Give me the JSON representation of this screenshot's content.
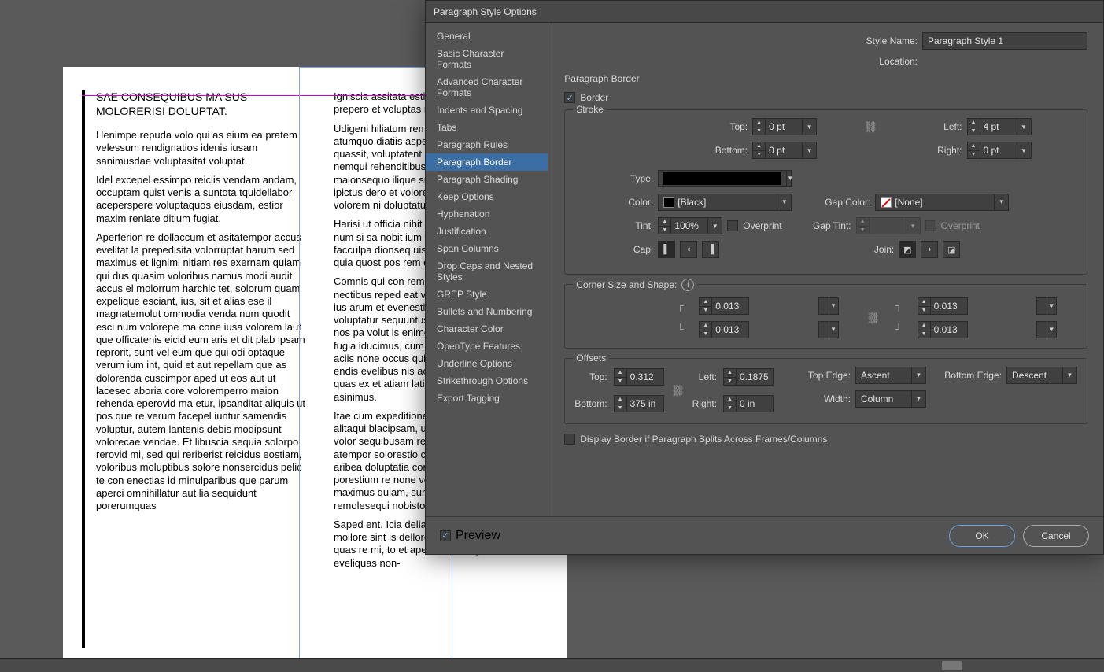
{
  "dialog": {
    "title": "Paragraph Style Options",
    "style_name_label": "Style Name:",
    "style_name_value": "Paragraph Style 1",
    "location_label": "Location:",
    "panel_title": "Paragraph Border",
    "preview_label": "Preview",
    "ok_label": "OK",
    "cancel_label": "Cancel"
  },
  "sidebar": {
    "items": [
      "General",
      "Basic Character Formats",
      "Advanced Character Formats",
      "Indents and Spacing",
      "Tabs",
      "Paragraph Rules",
      "Paragraph Border",
      "Paragraph Shading",
      "Keep Options",
      "Hyphenation",
      "Justification",
      "Span Columns",
      "Drop Caps and Nested Styles",
      "GREP Style",
      "Bullets and Numbering",
      "Character Color",
      "OpenType Features",
      "Underline Options",
      "Strikethrough Options",
      "Export Tagging"
    ],
    "active_index": 6
  },
  "border": {
    "checkbox_label": "Border",
    "stroke_legend": "Stroke",
    "top_label": "Top:",
    "top_value": "0 pt",
    "bottom_label": "Bottom:",
    "bottom_value": "0 pt",
    "left_label": "Left:",
    "left_value": "4 pt",
    "right_label": "Right:",
    "right_value": "0 pt",
    "type_label": "Type:",
    "color_label": "Color:",
    "color_value": "[Black]",
    "gap_color_label": "Gap Color:",
    "gap_color_value": "[None]",
    "tint_label": "Tint:",
    "tint_value": "100%",
    "overprint_label": "Overprint",
    "gap_tint_label": "Gap Tint:",
    "gap_overprint_label": "Overprint",
    "cap_label": "Cap:",
    "join_label": "Join:"
  },
  "corner": {
    "legend": "Corner Size and Shape:",
    "tl": "0.013",
    "tr": "0.013",
    "bl": "0.013",
    "br": "0.013"
  },
  "offsets": {
    "legend": "Offsets",
    "top_label": "Top:",
    "top_value": "0.312",
    "left_label": "Left:",
    "left_value": "0.1875",
    "bottom_label": "Bottom:",
    "bottom_value": "375 in",
    "right_label": "Right:",
    "right_value": "0 in",
    "top_edge_label": "Top Edge:",
    "top_edge_value": "Ascent",
    "bottom_edge_label": "Bottom Edge:",
    "bottom_edge_value": "Descent",
    "width_label": "Width:",
    "width_value": "Column"
  },
  "display_split_label": "Display Border if Paragraph Splits Across Frames/Columns",
  "doc": {
    "heading": "SAE CONSEQUIBUS MA SUS MOLORERISI DOLUPTAT.",
    "col1": [
      "Henimpe repuda volo qui as eium ea pratem velessum rendignatios idenis iusam sanimusdae voluptasitat voluptat.",
      "Idel excepel essimpo reiciis vendam andam, occuptam quist venis a suntota tquidellabor aceperspere voluptaquos eiusdam, estior maxim reniate ditium fugiat.",
      "Aperferion re dollaccum et asitatempor accus evelitat la prepedisita volorruptat harum sed maximus et lignimi nitiam res exernam quiam qui dus quasim voloribus namus modi audit accus el molorrum harchic tet, solorum quam expelique esciant, ius, sit et alias ese il magnatemolut ommodia venda num quodit esci num volorepe ma cone iusa volorem laut que officatenis eicid eum aris et dit plab ipsam reprorit, sunt vel eum que qui odi optaque verum ium int, quid et aut repellam que as dolorenda cuscimpor aped ut eos aut ut lacesec aboria core voloremperro maion rehenda eperovid ma etur, ipsanditat aliquis ut pos que re verum facepel iuntur samendis voluptur, autem lantenis debis modipsunt volorecae vendae. Et libuscia sequia solorpo rerovid mi, sed qui reriberist reicidus eostiam, voloribus moluptibus solore nonsercidus pelic te con enectias id minulparibus que parum aperci omnihillatur aut lia sequidunt porerumquas"
    ],
    "col2": [
      "Igniscia assitata estions editatur aut faci conet prepero et voluptas maionse ndaecab oreiciur?",
      "Udigeni hiliatum rem voluptae nonsequ atumquo diatiis asperat umento tem quo quassit, voluptatent maio. Mint et, id que nemqui rehenditibus sa nonem facepudae maionsequo ilique susa dolorro rporendae ipictus dero et voloressi utes eos audignisque volorem ni doluptatur?",
      "Harisi ut officia nihit volesti unt optat debit re num si sa nobit ium faceriae doluptaectas et facculpa dionseq uisquas quam sam simos quia quost pos rem etur?",
      "Comnis qui con rem volorae cestiatenis as ma nectibus reped eat velliasit apis aliquiam qui ius arum et evenestis rerum apid enissint voluptatur sequuntus sanis soloresciunt que nos pa volut is enimenditas ulluptia quiatumet fugia iducimus, cum fuga. Udignam alit opta aciis none occus qui dio. Ferum, nim dem es endis evelibus nis aciunt, core odi quae iusam quas ex et atiam latiam facia sinvell orruptas asinimus.",
      "Itae cum expeditionem vent idelenimpos alitaqui blacipsam, ut aut volores eos eaque volor sequibusam rernam qui tem et verchilles atempor solorestio cone doloriorem saes aribea doluptatia consequi ducisto ium dolenim porestium re none volor moluptatquo tes maximus quiam, sunt aut modis maximaxim remolesequi nobisto rerepelicto vellaud itatiunt.",
      "Saped ent. Icia deliand elesciet, si unt aped mollore sint is dellore, invelitas expeditiorum quas re mi, to et aperiamus magniam eveliquas non-"
    ]
  }
}
